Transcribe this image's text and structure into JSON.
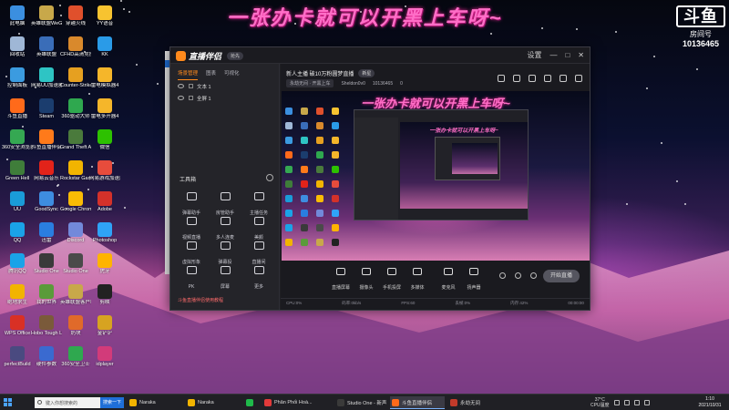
{
  "overlay": {
    "banner": "一张办卡就可以开黑上车呀~",
    "logo_text": "斗鱼",
    "room_label": "房间号",
    "room_number": "10136465"
  },
  "desktop_icons": [
    {
      "label": "此电脑",
      "color": "#3b8fe0"
    },
    {
      "label": "英雄联盟WeGame版",
      "color": "#c8a84a"
    },
    {
      "label": "穿越火线",
      "color": "#e0502c"
    },
    {
      "label": "YY语音",
      "color": "#f7c330"
    },
    {
      "label": "回收站",
      "color": "#9fb7d6"
    },
    {
      "label": "英雄联盟",
      "color": "#3a6db8"
    },
    {
      "label": "CFHD高清竞技大区",
      "color": "#d9892c"
    },
    {
      "label": "KK",
      "color": "#2a9be8"
    },
    {
      "label": "控制面板",
      "color": "#3b9be0"
    },
    {
      "label": "网易UU加速器",
      "color": "#2ec4c4"
    },
    {
      "label": "Counter-Strike Global Off...",
      "color": "#e6a020"
    },
    {
      "label": "雷电模拟器4",
      "color": "#f5b62a"
    },
    {
      "label": "斗鱼直播",
      "color": "#ff6a1a"
    },
    {
      "label": "Steam",
      "color": "#1b3d6e"
    },
    {
      "label": "360驱动大师",
      "color": "#2fa84f"
    },
    {
      "label": "雷电多开器4",
      "color": "#f5b62a"
    },
    {
      "label": "360安全浏览器",
      "color": "#35a852"
    },
    {
      "label": "斗鱼直播伴侣",
      "color": "#ff7a1a"
    },
    {
      "label": "Grand Theft Auto V",
      "color": "#4a7a3c"
    },
    {
      "label": "微信",
      "color": "#2dc100"
    },
    {
      "label": "Green Hell",
      "color": "#3f7d3a"
    },
    {
      "label": "网易云音乐",
      "color": "#e2231a"
    },
    {
      "label": "Rockstar Games...",
      "color": "#f2b400"
    },
    {
      "label": "网易游戏加速器",
      "color": "#e74c3c"
    },
    {
      "label": "UU",
      "color": "#1a9cd8"
    },
    {
      "label": "GoodSync",
      "color": "#3e8de0"
    },
    {
      "label": "Google Chrome",
      "color": "#fbbc05"
    },
    {
      "label": "Adobe",
      "color": "#d4312a"
    },
    {
      "label": "QQ",
      "color": "#1aa3e8"
    },
    {
      "label": "迅雷",
      "color": "#2a7ee0"
    },
    {
      "label": "Discord",
      "color": "#7289da"
    },
    {
      "label": "Photoshop",
      "color": "#2fa3f7"
    },
    {
      "label": "腾讯QQ",
      "color": "#1aa3e8"
    },
    {
      "label": "Studio One",
      "color": "#3a3a3a"
    },
    {
      "label": "Studio One",
      "color": "#4a4a4a"
    },
    {
      "label": "虎牙",
      "color": "#ffb400"
    },
    {
      "label": "绝地求生",
      "color": "#f2b400"
    },
    {
      "label": "我的世界",
      "color": "#5a9b3a"
    },
    {
      "label": "英雄联盟客户端",
      "color": "#c8a84a"
    },
    {
      "label": "剪映",
      "color": "#222222"
    },
    {
      "label": "WPS Office",
      "color": "#d93025"
    },
    {
      "label": "Hobo Tough Life",
      "color": "#7a5a3a"
    },
    {
      "label": "奶块",
      "color": "#e06a2a"
    },
    {
      "label": "金铲铲",
      "color": "#d7a321"
    },
    {
      "label": "perfectBuild",
      "color": "#4a4a80"
    },
    {
      "label": "硬件参数",
      "color": "#3a6ad0"
    },
    {
      "label": "360安全卫士",
      "color": "#2fa84f"
    },
    {
      "label": "idplayer",
      "color": "#d23b7a"
    }
  ],
  "app": {
    "brand_name": "直播伴侣",
    "version_badge": "抢先",
    "window_controls": [
      "设置",
      "—",
      "□",
      "✕"
    ],
    "sidebar": {
      "tabs": [
        {
          "label": "场景管理",
          "active": true
        },
        {
          "label": "图表",
          "active": false
        },
        {
          "label": "可视化",
          "active": false
        }
      ],
      "scenes": [
        {
          "label": "文本 1"
        },
        {
          "label": "全屏 1"
        }
      ],
      "tools_heading": "工具箱",
      "tools": [
        {
          "label": "弹幕助手"
        },
        {
          "label": "房管助手"
        },
        {
          "label": "主播任务"
        },
        {
          "label": "视频直播"
        },
        {
          "label": "多人连麦"
        },
        {
          "label": "美颜"
        },
        {
          "label": "虚拟形象"
        },
        {
          "label": "弹幕投"
        },
        {
          "label": "直播间"
        },
        {
          "label": "PK"
        },
        {
          "label": "屏幕"
        },
        {
          "label": "更多"
        }
      ],
      "footer": "斗鱼直播伴侣使用教程"
    },
    "room": {
      "title": "新人主播 破10万粉圆梦直播",
      "badge": "新星",
      "category": "永劫无间 · 开黑上车",
      "streamer": "Sheldon0v0",
      "room_id": "10136465",
      "likes": "0"
    },
    "preview_banner": "一张办卡就可以开黑上车呀~",
    "controls": [
      {
        "label": "直播屏幕"
      },
      {
        "label": "摄像头"
      },
      {
        "label": "手机投屏"
      },
      {
        "label": "多媒体"
      },
      {
        "label": "麦克风"
      },
      {
        "label": "扬声器"
      }
    ],
    "start_button": "开始直播",
    "status": {
      "cpu": "CPU:0%",
      "bitrate": "码率:0kb/s",
      "fps": "FPS:60",
      "drop": "丢帧:0%",
      "memory": "内存:42%",
      "time": "00:00:00"
    }
  },
  "taskbar": {
    "search_placeholder": "键入你想搜索的",
    "search_button": "搜索一下",
    "tasks": [
      {
        "label": "Naraka",
        "color": "#f2b400",
        "active": false
      },
      {
        "label": "Naraka",
        "color": "#f2b400",
        "active": false
      },
      {
        "label": "",
        "color": "#1fba4a",
        "active": false
      },
      {
        "label": "Phân Phối Hoà...",
        "color": "#e23a3a",
        "active": false
      },
      {
        "label": "Studio One - 新声...",
        "color": "#3a3a3a",
        "active": false
      },
      {
        "label": "斗鱼直播伴侣",
        "color": "#ff6a1a",
        "active": true
      },
      {
        "label": "永劫无间",
        "color": "#c23a2a",
        "active": false
      }
    ],
    "weather": "37°C",
    "weather_sub": "CPU温度",
    "time": "1:10",
    "date": "2021/10/31"
  }
}
